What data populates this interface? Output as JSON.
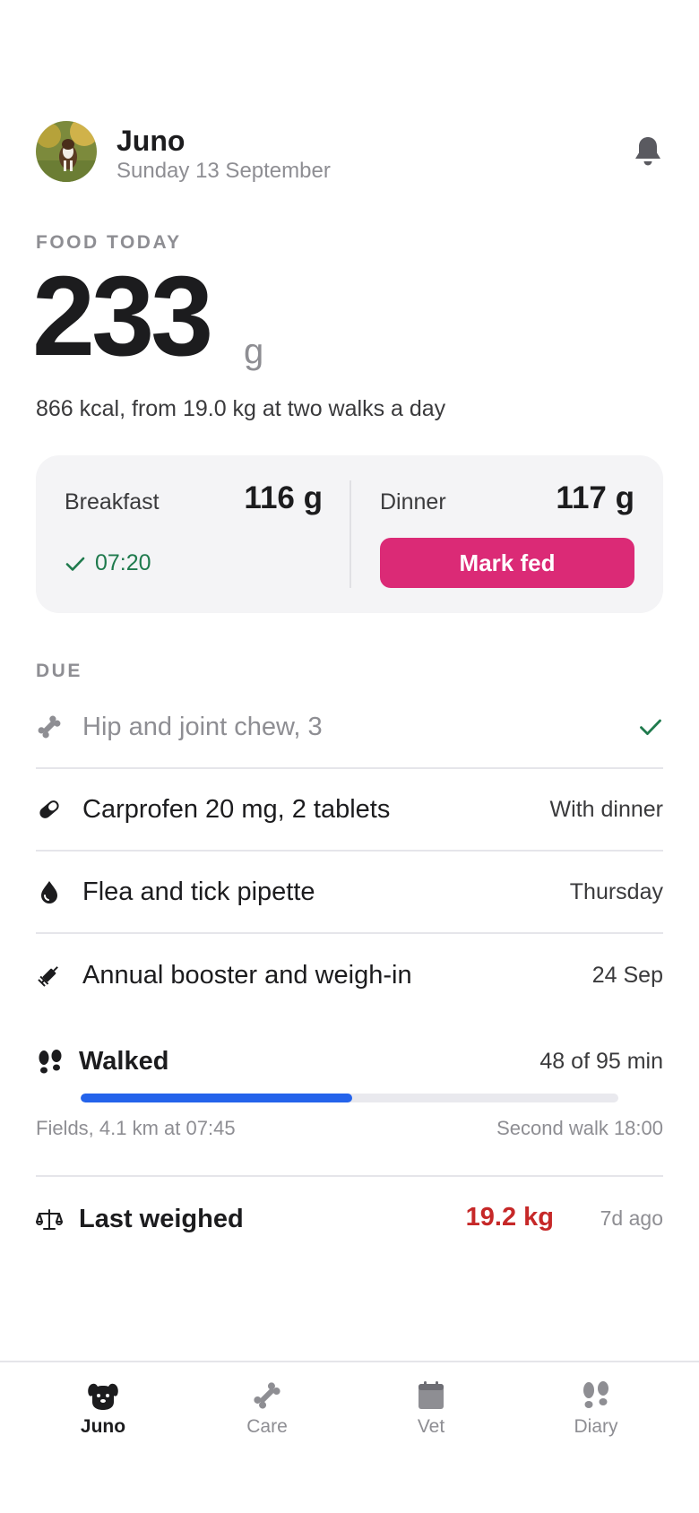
{
  "header": {
    "pet_name": "Juno",
    "date": "Sunday 13 September",
    "avatar_icon": "dog-photo-avatar",
    "bell_icon": "bell-icon"
  },
  "food": {
    "section_label": "FOOD TODAY",
    "amount": "233",
    "unit": "g",
    "subtitle": "866 kcal, from 19.0 kg at two walks a day",
    "meals": {
      "breakfast": {
        "label": "Breakfast",
        "amount": "116 g",
        "status": "07:20"
      },
      "dinner": {
        "label": "Dinner",
        "amount": "117 g",
        "button": "Mark fed"
      }
    }
  },
  "due": {
    "section_label": "DUE",
    "items": [
      {
        "icon": "bone-icon",
        "label": "Hip and joint chew, 3",
        "when": "",
        "done": true
      },
      {
        "icon": "pill-icon",
        "label": "Carprofen 20 mg, 2 tablets",
        "when": "With dinner",
        "done": false
      },
      {
        "icon": "drop-icon",
        "label": "Flea and tick pipette",
        "when": "Thursday",
        "done": false
      },
      {
        "icon": "syringe-icon",
        "label": "Annual booster and weigh-in",
        "when": "24 Sep",
        "done": false
      }
    ]
  },
  "walk": {
    "title": "Walked",
    "count": "48 of 95 min",
    "progress": 0.505,
    "last": "Fields, 4.1 km at 07:45",
    "next": "Second walk 18:00"
  },
  "weight": {
    "title": "Last weighed",
    "value": "19.2 kg",
    "ago": "7d ago"
  },
  "tabs": [
    {
      "label": "Juno",
      "icon": "dog-icon",
      "active": true
    },
    {
      "label": "Care",
      "icon": "bone-icon",
      "active": false
    },
    {
      "label": "Vet",
      "icon": "calendar-icon",
      "active": false
    },
    {
      "label": "Diary",
      "icon": "footprints-icon",
      "active": false
    }
  ],
  "colors": {
    "accent": "#db2a76",
    "progress": "#2463eb",
    "success": "#1f7a4d",
    "warning": "#c62828"
  }
}
